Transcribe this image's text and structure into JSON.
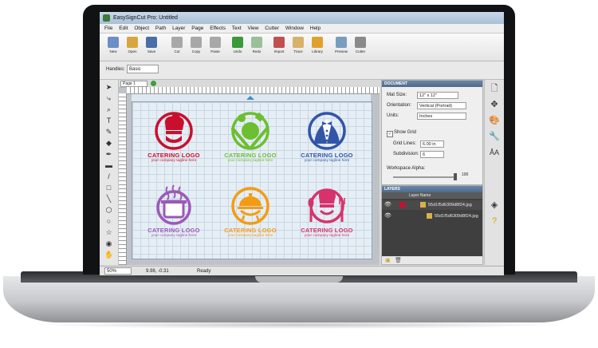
{
  "window": {
    "title": "EasySignCut Pro: Untitled"
  },
  "menu": [
    "File",
    "Edit",
    "Object",
    "Path",
    "Layer",
    "Page",
    "Effects",
    "Text",
    "View",
    "Cutter",
    "Window",
    "Help"
  ],
  "toolbar": [
    {
      "label": "New",
      "icon": "new-file-icon",
      "color": "#6b8fc4"
    },
    {
      "label": "Open",
      "icon": "open-folder-icon",
      "color": "#d8a640"
    },
    {
      "label": "Save",
      "icon": "save-disk-icon",
      "color": "#4a6fa8"
    },
    {
      "label": "Cut",
      "icon": "scissors-icon",
      "color": "#a8a8a8"
    },
    {
      "label": "Copy",
      "icon": "copy-icon",
      "color": "#a8a8a8"
    },
    {
      "label": "Paste",
      "icon": "paste-icon",
      "color": "#a8a8a8"
    },
    {
      "label": "Undo",
      "icon": "undo-icon",
      "color": "#3a9a3a"
    },
    {
      "label": "Redo",
      "icon": "redo-icon",
      "color": "#9ac09a"
    },
    {
      "label": "Import",
      "icon": "import-icon",
      "color": "#c05050"
    },
    {
      "label": "Trace",
      "icon": "trace-icon",
      "color": "#d6b26b"
    },
    {
      "label": "Library",
      "icon": "library-icon",
      "color": "#e0a030"
    },
    {
      "label": "Preview",
      "icon": "preview-icon",
      "color": "#7a9cc0"
    },
    {
      "label": "Cutter",
      "icon": "cutter-icon",
      "color": "#8a8a8a"
    }
  ],
  "handles": {
    "label": "Handles:",
    "value": "Basic"
  },
  "page_tab": {
    "label": "Page 1"
  },
  "logos": [
    {
      "title": "CATERING LOGO",
      "tagline": "your company tagline here",
      "color": "#c8102e",
      "taglineColor": "#c8102e",
      "icon": "chef-hat-logo-icon"
    },
    {
      "title": "CATERING LOGO",
      "tagline": "your company tagline here",
      "color": "#6cbf30",
      "taglineColor": "#6cbf30",
      "icon": "plate-utensils-logo-icon"
    },
    {
      "title": "CATERING LOGO",
      "tagline": "your company tagline here",
      "color": "#3355a8",
      "taglineColor": "#3355a8",
      "icon": "waiter-tuxedo-logo-icon"
    },
    {
      "title": "CATERING LOGO",
      "tagline": "your company tagline here",
      "color": "#9b59b6",
      "taglineColor": "#9b59b6",
      "icon": "cooking-pot-logo-icon"
    },
    {
      "title": "CATERING LOGO",
      "tagline": "your company tagline here",
      "color": "#f39c12",
      "taglineColor": "#f39c12",
      "icon": "grill-logo-icon"
    },
    {
      "title": "CATERING LOGO",
      "tagline": "your company tagline here",
      "color": "#d6336c",
      "taglineColor": "#d6336c",
      "icon": "chef-cutlery-logo-icon"
    }
  ],
  "document_panel": {
    "header": "DOCUMENT",
    "mat_size": {
      "label": "Mat Size:",
      "value": "12\" x 12\""
    },
    "orientation": {
      "label": "Orientation:",
      "value": "Vertical (Portrait)"
    },
    "units": {
      "label": "Units:",
      "value": "Inches"
    },
    "show_grid": {
      "label": "Show Grid",
      "checked": true
    },
    "grid_lines": {
      "label": "Grid Lines:",
      "value": "6.00 in"
    },
    "subdivision": {
      "label": "Subdivision:",
      "value": "6"
    },
    "workspace_alpha": {
      "label": "Workspace Alpha:",
      "value": "100"
    }
  },
  "layers_panel": {
    "header": "LAYERS",
    "col_name": "Layer Name",
    "rows": [
      {
        "name": "55d1f5d6309d8f24.jpg"
      },
      {
        "name": "55d1f5d6309d8f24.jpg"
      }
    ]
  },
  "status": {
    "zoom": "50%",
    "coords": "9.98, -0.31",
    "message": "Ready"
  }
}
